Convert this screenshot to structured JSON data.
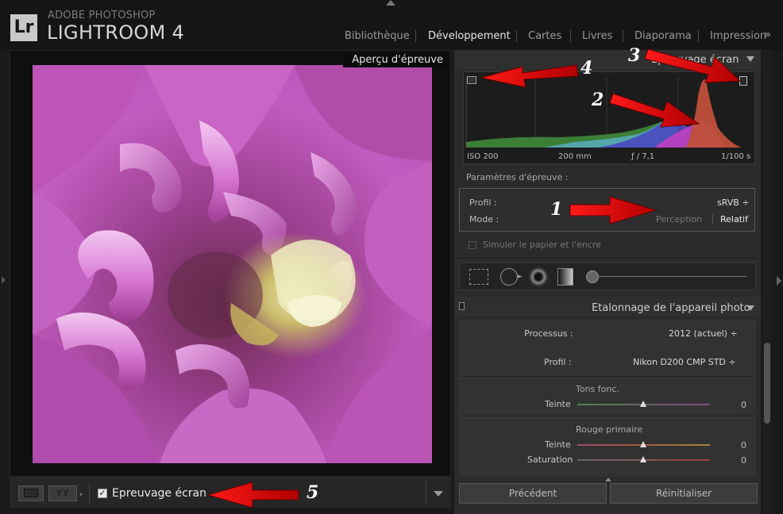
{
  "app": {
    "brand_small": "ADOBE PHOTOSHOP",
    "brand_big": "LIGHTROOM 4",
    "logo": "Lr"
  },
  "modules": [
    {
      "label": "Bibliothèque",
      "active": false
    },
    {
      "label": "Développement",
      "active": true
    },
    {
      "label": "Cartes",
      "active": false
    },
    {
      "label": "Livres",
      "active": false
    },
    {
      "label": "Diaporama",
      "active": false
    },
    {
      "label": "Impression",
      "active": false
    }
  ],
  "module_more": "»",
  "preview_label": "Aperçu d'épreuve",
  "toolbar": {
    "view_icon": "loupe-view-icon",
    "yy_label": "YY",
    "proof_checked": true,
    "proof_check_mark": "✓",
    "proof_label": "Epreuvage écran"
  },
  "soft_proof_panel": {
    "title": "Epreuvage écran",
    "histogram": {
      "iso": "ISO 200",
      "focal": "200 mm",
      "aperture": "ƒ / 7,1",
      "shutter": "1/100 s"
    },
    "params_label": "Paramètres d'épreuve :",
    "profile_label": "Profil :",
    "profile_value": "sRVB ÷",
    "mode_label": "Mode :",
    "mode_perception": "Perception",
    "mode_relatif": "Relatif",
    "simulate_label": "Simuler le papier et l'encre",
    "simulate_checked": false
  },
  "calibration_panel": {
    "title": "Etalonnage de l'appareil photo",
    "process_label": "Processus :",
    "process_value": "2012 (actuel) ÷",
    "profile_label": "Profil :",
    "profile_value": "Nikon D200 CMP STD ÷",
    "shadows_title": "Tons fonc.",
    "shadows_tint_label": "Teinte",
    "shadows_tint_value": "0",
    "red_title": "Rouge primaire",
    "red_tint_label": "Teinte",
    "red_tint_value": "0",
    "red_sat_label": "Saturation",
    "red_sat_value": "0"
  },
  "buttons": {
    "previous": "Précédent",
    "reset": "Réinitialiser"
  },
  "annotations": [
    "1",
    "2",
    "3",
    "4",
    "5"
  ],
  "colors": {
    "annotation_arrow": "#e00000",
    "background": "#1a1a1a",
    "panel": "#2b2b2b",
    "flower_pink": "#c45ac4"
  }
}
